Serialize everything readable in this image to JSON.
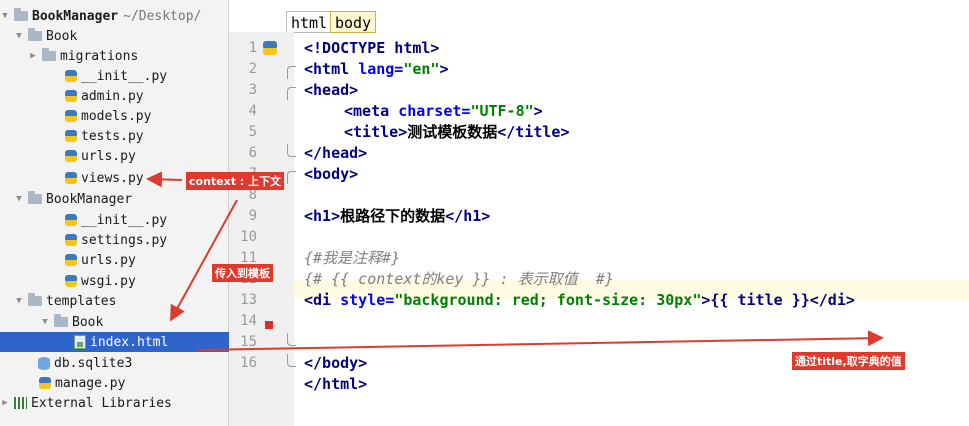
{
  "tree": {
    "project_name": "BookManager",
    "project_path": "~/Desktop/",
    "items": [
      {
        "label": "Book"
      },
      {
        "label": "migrations"
      },
      {
        "label": "__init__.py"
      },
      {
        "label": "admin.py"
      },
      {
        "label": "models.py"
      },
      {
        "label": "tests.py"
      },
      {
        "label": "urls.py"
      },
      {
        "label": "views.py"
      },
      {
        "label": "BookManager"
      },
      {
        "label": "__init__.py"
      },
      {
        "label": "settings.py"
      },
      {
        "label": "urls.py"
      },
      {
        "label": "wsgi.py"
      },
      {
        "label": "templates"
      },
      {
        "label": "Book"
      },
      {
        "label": "index.html"
      },
      {
        "label": "db.sqlite3"
      },
      {
        "label": "manage.py"
      },
      {
        "label": "External Libraries"
      }
    ]
  },
  "editor": {
    "breadcrumbs": [
      "html",
      "body"
    ],
    "line_numbers": [
      "1",
      "2",
      "3",
      "4",
      "5",
      "6",
      "7",
      "8",
      "9",
      "10",
      "11",
      "12",
      "13",
      "14",
      "15",
      "16"
    ],
    "code": {
      "l1": {
        "tag": "<!DOCTYPE html>"
      },
      "l2": {
        "open": "<html ",
        "attr": "lang=",
        "val": "\"en\"",
        "close": ">"
      },
      "l3": {
        "tag": "<head>"
      },
      "l4": {
        "open": "<meta ",
        "attr": "charset=",
        "val": "\"UTF-8\"",
        "close": ">"
      },
      "l5": {
        "open": "<title>",
        "text": "测试模板数据",
        "close": "</title>"
      },
      "l6": {
        "tag": "</head>"
      },
      "l7": {
        "tag": "<body>"
      },
      "l9": {
        "open": "<h1>",
        "text": "根路径下的数据",
        "close": "</h1>"
      },
      "l11": {
        "comment": "{#我是注释#}"
      },
      "l12": {
        "comment": "{# {{ context的key }} : 表示取值  #}"
      },
      "l13": {
        "open": "<di ",
        "attr": "style=",
        "val": "\"background: red; font-size: 30px\"",
        "close": ">",
        "tpl": "{{ title }}",
        "end": "</di>"
      },
      "l15": {
        "tag": "</body>"
      },
      "l16": {
        "tag": "</html>"
      }
    }
  },
  "annotations": {
    "context": "context : 上下文",
    "pass_to_template": "传入到模板",
    "dict_value": "通过title,取字典的值"
  },
  "colors": {
    "selection": "#2f65ca",
    "annotation_red": "#e03a2e",
    "tag": "#000080",
    "string": "#008000",
    "comment": "#808080"
  }
}
